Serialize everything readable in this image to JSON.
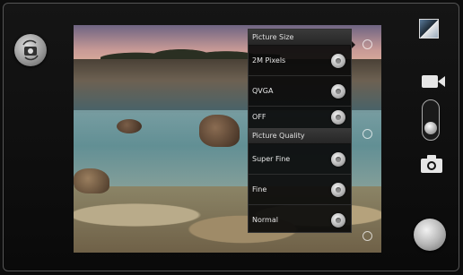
{
  "settings_menu": {
    "picture_size": {
      "title": "Picture Size",
      "options": [
        "2M Pixels",
        "QVGA",
        "OFF"
      ]
    },
    "picture_quality": {
      "title": "Picture Quality",
      "options": [
        "Super Fine",
        "Fine",
        "Normal"
      ]
    }
  },
  "controls": {
    "switch_camera_icon": "camera-switch-icon",
    "gallery_thumbnail_icon": "gallery-thumbnail",
    "video_mode_icon": "video-camera-icon",
    "photo_mode_icon": "camera-icon",
    "shutter_icon": "shutter-button"
  },
  "colors": {
    "background": "#0d0d0d",
    "menu_background": "#0a0a0a",
    "section_header": "#2f2f2f",
    "text": "#e8e8e8"
  }
}
